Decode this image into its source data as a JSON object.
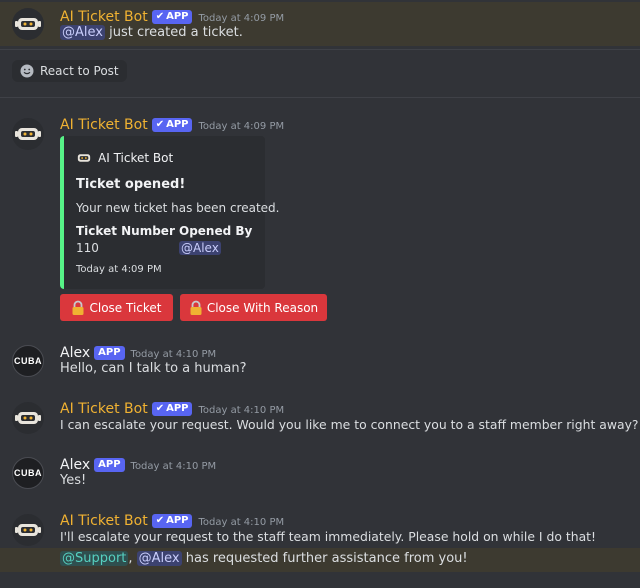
{
  "colors": {
    "background": "#313338",
    "bot_name": "#f0b232",
    "app_tag": "#5865f2",
    "danger_button": "#da373c",
    "embed_accent": "#57f287",
    "mention_highlight": "#3d3a30"
  },
  "messages": [
    {
      "author": "AI Ticket Bot",
      "tag": "APP",
      "verified": true,
      "time": "Today at 4:09 PM",
      "mention": "@Alex",
      "text": " just created a ticket."
    },
    {
      "author": "AI Ticket Bot",
      "tag": "APP",
      "verified": true,
      "time": "Today at 4:09 PM"
    },
    {
      "author": "Alex",
      "tag": "APP",
      "time": "Today at 4:10 PM",
      "text": "Hello, can I talk to a human?",
      "avatar_label": "CUBA"
    },
    {
      "author": "AI Ticket Bot",
      "tag": "APP",
      "verified": true,
      "time": "Today at 4:10 PM",
      "text": "I can escalate your request. Would you like me to connect you to a staff member right away?"
    },
    {
      "author": "Alex",
      "tag": "APP",
      "time": "Today at 4:10 PM",
      "text": "Yes!",
      "avatar_label": "CUBA"
    },
    {
      "author": "AI Ticket Bot",
      "tag": "APP",
      "verified": true,
      "time": "Today at 4:10 PM",
      "text": "I'll escalate your request to the staff team immediately. Please hold on while I do that!",
      "line2_role": "@Support",
      "line2_sep": ", ",
      "line2_mention": "@Alex",
      "line2_text": " has requested further assistance from you!"
    }
  ],
  "react": {
    "label": "React to Post",
    "icon": "smiley-icon"
  },
  "embed": {
    "author": "AI Ticket Bot",
    "title": "Ticket opened!",
    "description": "Your new ticket has been created.",
    "fields": [
      {
        "name": "Ticket Number",
        "value": "110"
      },
      {
        "name": "Opened By",
        "value": "@Alex"
      }
    ],
    "footer": "Today at 4:09 PM"
  },
  "buttons": [
    {
      "label": "Close Ticket",
      "icon": "lock-icon"
    },
    {
      "label": "Close With Reason",
      "icon": "lock-icon"
    }
  ]
}
